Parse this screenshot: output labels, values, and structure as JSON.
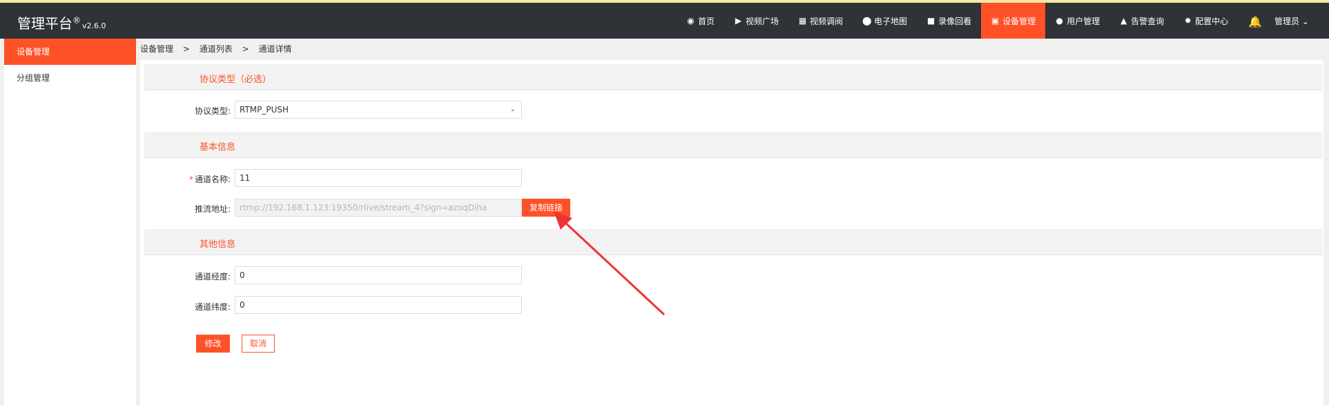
{
  "app": {
    "title": "管理平台",
    "registered": "®",
    "version": "v2.6.0"
  },
  "nav": [
    {
      "icon": "◉",
      "iconName": "dashboard-icon",
      "label": "首页"
    },
    {
      "icon": "▶",
      "iconName": "play-icon",
      "label": "视频广场"
    },
    {
      "icon": "▦",
      "iconName": "grid-icon",
      "label": "视频调阅"
    },
    {
      "icon": "⬤",
      "iconName": "map-pin-icon",
      "label": "电子地图"
    },
    {
      "icon": "■",
      "iconName": "video-camera-icon",
      "label": "录像回看"
    },
    {
      "icon": "▣",
      "iconName": "device-icon",
      "label": "设备管理",
      "active": true
    },
    {
      "icon": "●",
      "iconName": "user-icon",
      "label": "用户管理"
    },
    {
      "icon": "▲",
      "iconName": "alarm-icon",
      "label": "告警查询"
    },
    {
      "icon": "✹",
      "iconName": "gear-icon",
      "label": "配置中心"
    }
  ],
  "header": {
    "bellIcon": "bell-icon",
    "user": "管理员",
    "caret": "⌄"
  },
  "sidebar": {
    "items": [
      {
        "label": "设备管理",
        "active": true
      },
      {
        "label": "分组管理"
      }
    ]
  },
  "breadcrumb": {
    "items": [
      "设备管理",
      ">",
      "通道列表",
      ">",
      "通道详情"
    ]
  },
  "form": {
    "section1": "协议类型（必选）",
    "protocol_label": "协议类型:",
    "protocol_value": "RTMP_PUSH",
    "section2": "基本信息",
    "required_mark": "*",
    "channel_name_label": "通道名称:",
    "channel_name_value": "11",
    "push_url_label": "推流地址:",
    "push_url_value": "rtmp://192.168.1.123:19350/rlive/stream_4?sign=azoqDiha",
    "copy_button": "复制链接",
    "section3": "其他信息",
    "longitude_label": "通道经度:",
    "longitude_value": "0",
    "latitude_label": "通道纬度:",
    "latitude_value": "0",
    "submit": "修改",
    "cancel": "取消"
  },
  "colors": {
    "accent": "#fe5128",
    "topbar": "#2f3236",
    "annotation": "#ee3333"
  }
}
